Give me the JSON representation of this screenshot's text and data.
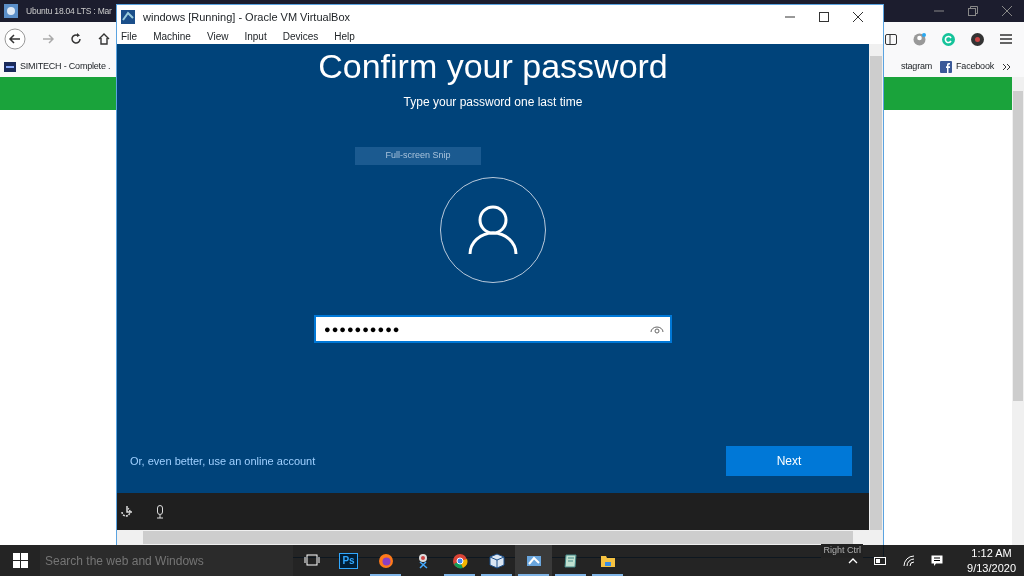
{
  "background_browser": {
    "title": "Ubuntu 18.04 LTS : Mar",
    "bookmarks": [
      {
        "label": "SIMITECH - Complete .",
        "kind": "site"
      },
      {
        "label": "stagram",
        "kind": "plain"
      },
      {
        "label": "Facebook",
        "kind": "facebook"
      }
    ]
  },
  "vm_window": {
    "title": "windows [Running] - Oracle VM VirtualBox",
    "menu": [
      "File",
      "Machine",
      "View",
      "Input",
      "Devices",
      "Help"
    ],
    "status_hint": "Right Ctrl"
  },
  "guest": {
    "heading": "Confirm your password",
    "subheading": "Type your password one last time",
    "tooltip": "Full-screen Snip",
    "password": {
      "value": "●●●●●●●●●●"
    },
    "link": "Or, even better, use an online account",
    "button": "Next"
  },
  "taskbar": {
    "search_placeholder": "Search the web and Windows",
    "apps": [
      {
        "kind": "taskview",
        "running": false,
        "selected": false
      },
      {
        "kind": "photoshop",
        "label": "Ps",
        "running": false,
        "selected": false
      },
      {
        "kind": "firefox",
        "running": true,
        "selected": false
      },
      {
        "kind": "snip",
        "running": false,
        "selected": false
      },
      {
        "kind": "chrome",
        "running": true,
        "selected": false
      },
      {
        "kind": "virtualbox",
        "running": true,
        "selected": false
      },
      {
        "kind": "vmwindow",
        "running": true,
        "selected": true
      },
      {
        "kind": "notes",
        "running": true,
        "selected": false
      },
      {
        "kind": "folder",
        "running": true,
        "selected": false
      }
    ],
    "time": "1:12 AM",
    "date": "9/13/2020"
  }
}
